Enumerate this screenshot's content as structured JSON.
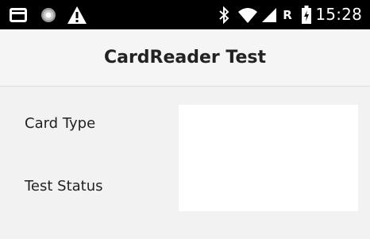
{
  "status_bar": {
    "time": "15:28",
    "network_roaming_indicator": "R",
    "icons": [
      "card-icon",
      "loading-spinner-icon",
      "warning-icon",
      "bluetooth-icon",
      "wifi-icon",
      "cell-signal-icon",
      "battery-charging-icon"
    ]
  },
  "app_bar": {
    "title": "CardReader Test"
  },
  "form": {
    "card_type_label": "Card Type",
    "test_status_label": "Test Status",
    "card_type_value": "",
    "test_status_value": ""
  },
  "colors": {
    "status_bar_bg": "#000000",
    "app_bar_bg": "#f5f5f5",
    "content_bg": "#f2f2f2",
    "panel_bg": "#ffffff",
    "text": "#222222"
  }
}
